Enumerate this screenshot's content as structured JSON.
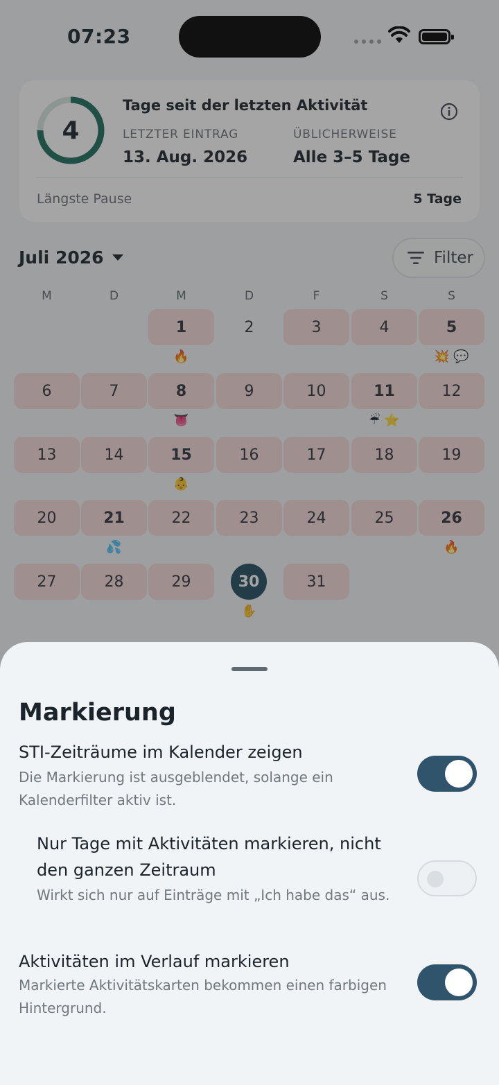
{
  "status": {
    "time": "07:23"
  },
  "stats": {
    "days": "4",
    "title": "Tage seit der letzten Aktivität",
    "last_label": "LETZTER EINTRAG",
    "last_value": "13. Aug. 2026",
    "usual_label": "ÜBLICHERWEISE",
    "usual_value": "Alle 3–5 Tage",
    "pause_label": "Längste Pause",
    "pause_value": "5 Tage"
  },
  "calendar": {
    "month": "Juli 2026",
    "filter_label": "Filter",
    "weekdays": [
      "M",
      "D",
      "M",
      "D",
      "F",
      "S",
      "S"
    ],
    "days": [
      {
        "n": "1",
        "bold": true,
        "pink": true,
        "emoji": "🔥"
      },
      {
        "n": "2",
        "bold": false,
        "pink": false,
        "emoji": ""
      },
      {
        "n": "3",
        "bold": false,
        "pink": true,
        "emoji": ""
      },
      {
        "n": "4",
        "bold": false,
        "pink": true,
        "emoji": ""
      },
      {
        "n": "5",
        "bold": true,
        "pink": true,
        "emoji": "💥 💬"
      },
      {
        "n": "6",
        "bold": false,
        "pink": true,
        "emoji": ""
      },
      {
        "n": "7",
        "bold": false,
        "pink": true,
        "emoji": ""
      },
      {
        "n": "8",
        "bold": true,
        "pink": true,
        "emoji": "👅"
      },
      {
        "n": "9",
        "bold": false,
        "pink": true,
        "emoji": ""
      },
      {
        "n": "10",
        "bold": false,
        "pink": true,
        "emoji": ""
      },
      {
        "n": "11",
        "bold": true,
        "pink": true,
        "emoji": "☔ ⭐"
      },
      {
        "n": "12",
        "bold": false,
        "pink": true,
        "emoji": ""
      },
      {
        "n": "13",
        "bold": false,
        "pink": true,
        "emoji": ""
      },
      {
        "n": "14",
        "bold": false,
        "pink": true,
        "emoji": ""
      },
      {
        "n": "15",
        "bold": true,
        "pink": true,
        "emoji": "👶"
      },
      {
        "n": "16",
        "bold": false,
        "pink": true,
        "emoji": ""
      },
      {
        "n": "17",
        "bold": false,
        "pink": true,
        "emoji": ""
      },
      {
        "n": "18",
        "bold": false,
        "pink": true,
        "emoji": ""
      },
      {
        "n": "19",
        "bold": false,
        "pink": true,
        "emoji": ""
      },
      {
        "n": "20",
        "bold": false,
        "pink": true,
        "emoji": ""
      },
      {
        "n": "21",
        "bold": true,
        "pink": true,
        "emoji": "💦"
      },
      {
        "n": "22",
        "bold": false,
        "pink": true,
        "emoji": ""
      },
      {
        "n": "23",
        "bold": false,
        "pink": true,
        "emoji": ""
      },
      {
        "n": "24",
        "bold": false,
        "pink": true,
        "emoji": ""
      },
      {
        "n": "25",
        "bold": false,
        "pink": true,
        "emoji": ""
      },
      {
        "n": "26",
        "bold": true,
        "pink": true,
        "emoji": "🔥"
      },
      {
        "n": "27",
        "bold": false,
        "pink": true,
        "emoji": ""
      },
      {
        "n": "28",
        "bold": false,
        "pink": true,
        "emoji": ""
      },
      {
        "n": "29",
        "bold": false,
        "pink": true,
        "emoji": ""
      },
      {
        "n": "30",
        "bold": true,
        "pink": true,
        "today": true,
        "emoji": "✋"
      },
      {
        "n": "31",
        "bold": false,
        "pink": true,
        "emoji": ""
      }
    ]
  },
  "sheet": {
    "title": "Markierung",
    "options": [
      {
        "title": "STI-Zeiträume im Kalender zeigen",
        "sub": "Die Markierung ist ausgeblendet, solange ein Kalenderfilter aktiv ist.",
        "on": true
      },
      {
        "title": "Nur Tage mit Aktivitäten markieren, nicht den ganzen Zeitraum",
        "sub": "Wirkt sich nur auf Einträge mit „Ich habe das“ aus.",
        "on": false
      },
      {
        "title": "Aktivitäten im Verlauf markieren",
        "sub": "Markierte Aktivitätskarten bekommen einen farbigen Hintergrund.",
        "on": true
      }
    ]
  },
  "colors": {
    "accent": "#1f4c5f",
    "ring": "#1a6b5a",
    "highlight_day": "#f5dad8",
    "toggle_on": "#2f546b"
  }
}
